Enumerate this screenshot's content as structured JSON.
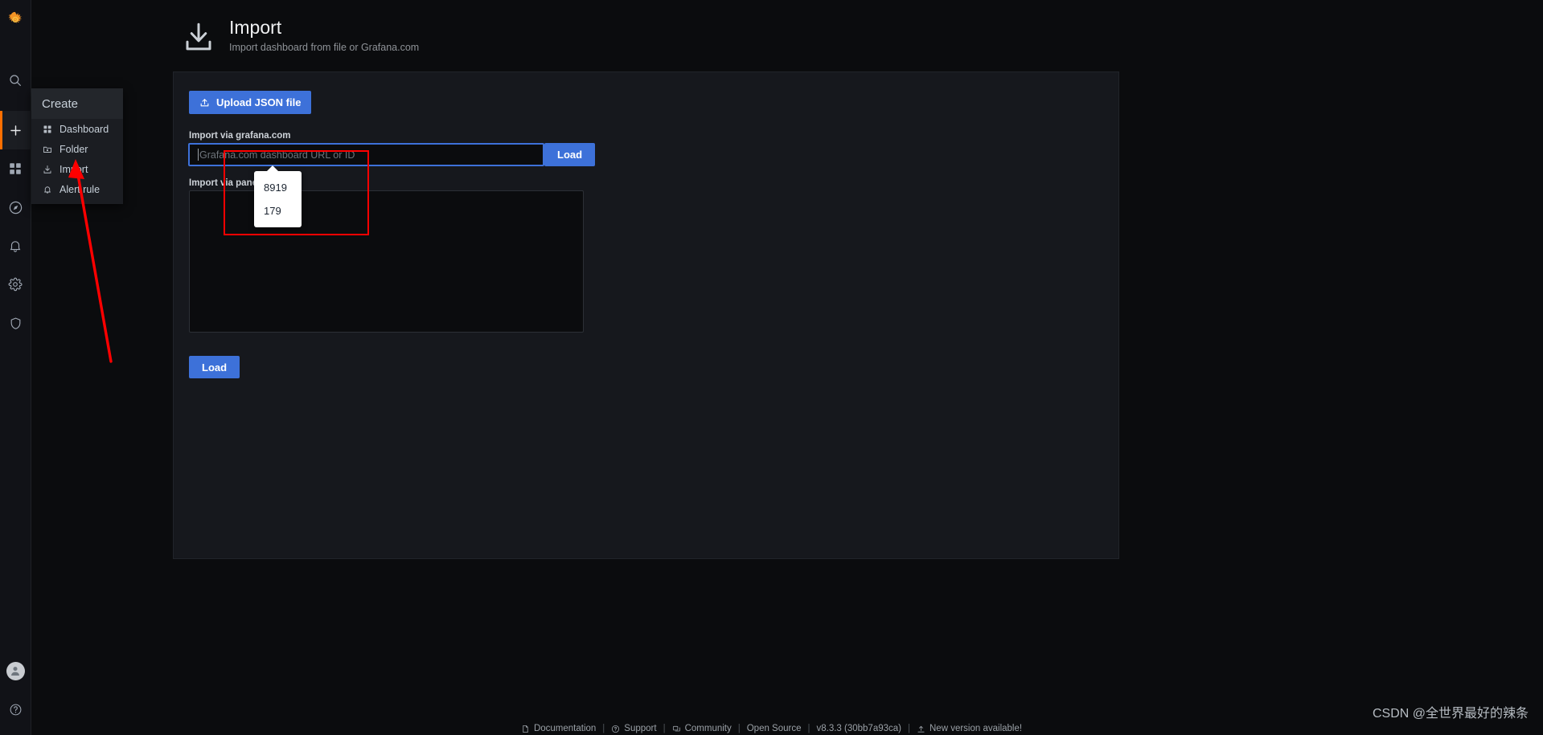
{
  "navrail": {
    "logo": "grafana-logo",
    "items": [
      {
        "icon": "search-icon",
        "name": "search"
      },
      {
        "icon": "plus-icon",
        "name": "create",
        "active": true
      },
      {
        "icon": "dashboards-grid-icon",
        "name": "dashboards"
      },
      {
        "icon": "compass-icon",
        "name": "explore"
      },
      {
        "icon": "bell-icon",
        "name": "alerting"
      },
      {
        "icon": "gear-icon",
        "name": "configuration"
      },
      {
        "icon": "shield-icon",
        "name": "server-admin"
      }
    ],
    "bottom": [
      {
        "icon": "avatar-icon",
        "name": "user-profile"
      },
      {
        "icon": "question-circle-icon",
        "name": "help"
      }
    ]
  },
  "create_menu": {
    "title": "Create",
    "items": [
      {
        "label": "Dashboard",
        "icon": "dashboard-icon"
      },
      {
        "label": "Folder",
        "icon": "folder-icon"
      },
      {
        "label": "Import",
        "icon": "import-download-icon"
      },
      {
        "label": "Alert rule",
        "icon": "alert-bell-icon"
      }
    ]
  },
  "header": {
    "icon": "import-download-icon",
    "title": "Import",
    "subtitle": "Import dashboard from file or Grafana.com"
  },
  "panel": {
    "upload_button": "Upload JSON file",
    "upload_icon": "upload-icon",
    "grafana_com_label": "Import via grafana.com",
    "grafana_com_placeholder": "Grafana.com dashboard URL or ID",
    "grafana_com_value": "",
    "grafana_com_load_button": "Load",
    "panel_json_label": "Import via panel json",
    "panel_json_value": "",
    "json_load_button": "Load"
  },
  "autofill": {
    "items": [
      "8919",
      "179"
    ]
  },
  "footer": {
    "links": [
      {
        "label": "Documentation",
        "icon": "doc-icon"
      },
      {
        "label": "Support",
        "icon": "support-icon"
      },
      {
        "label": "Community",
        "icon": "community-icon"
      },
      {
        "label": "Open Source",
        "icon": "none"
      },
      {
        "label": "v8.3.3 (30bb7a93ca)",
        "icon": "none"
      },
      {
        "label": "New version available!",
        "icon": "update-icon"
      }
    ],
    "separator": "|"
  },
  "watermark": "CSDN @全世界最好的辣条",
  "colors": {
    "accent_blue": "#3d71d9",
    "annotation_red": "#ff0000",
    "nav_active": "#ff6f00",
    "panel_bg": "#16181d"
  }
}
